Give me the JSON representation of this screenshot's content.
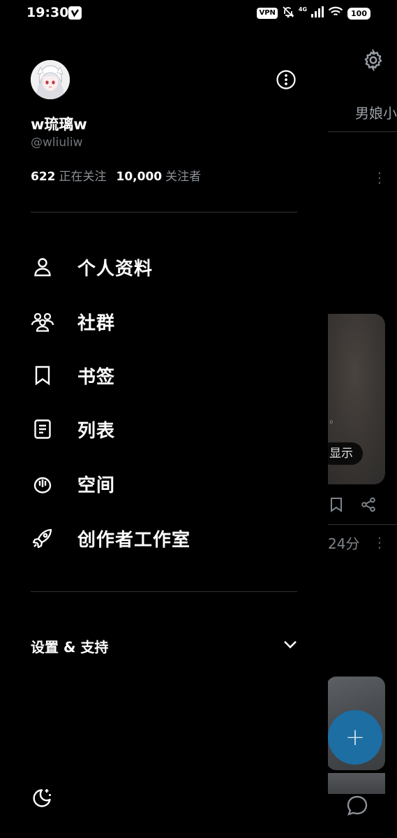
{
  "status_bar": {
    "time": "19:30",
    "vpn": "VPN",
    "network": "4G",
    "battery": "100"
  },
  "profile": {
    "display_name": "w琉璃w",
    "handle": "@wliuliw",
    "following_count": "622",
    "following_label": "正在关注",
    "followers_count": "10,000",
    "followers_label": "关注者"
  },
  "menu": [
    {
      "label": "个人资料",
      "icon": "person-icon"
    },
    {
      "label": "社群",
      "icon": "communities-icon"
    },
    {
      "label": "书签",
      "icon": "bookmark-icon"
    },
    {
      "label": "列表",
      "icon": "list-icon"
    },
    {
      "label": "空间",
      "icon": "spaces-icon"
    },
    {
      "label": "创作者工作室",
      "icon": "rocket-icon"
    }
  ],
  "settings_section": {
    "label": "设置 & 支持"
  },
  "background_timeline": {
    "tab_partial": "男娘小",
    "show_pill": "显示",
    "period_text": "。",
    "time_partial": "24分"
  }
}
